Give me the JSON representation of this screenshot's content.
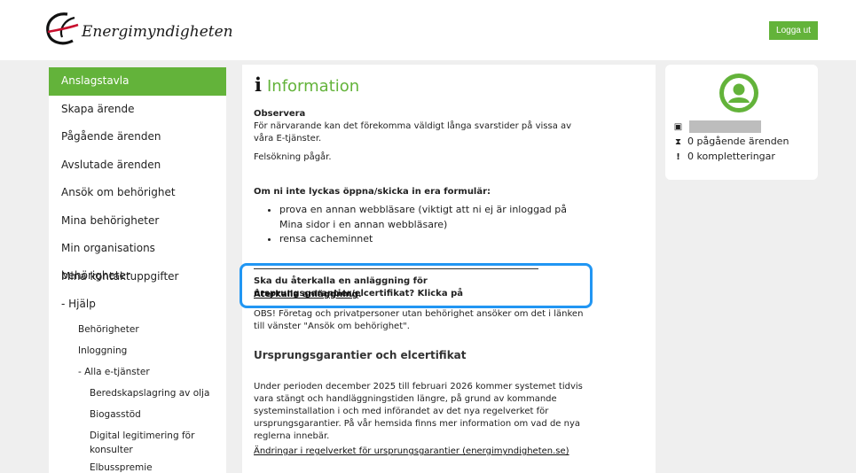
{
  "header": {
    "logo_text": "Energimyndigheten",
    "logout_label": "Logga ut"
  },
  "sidebar": {
    "items": [
      {
        "label": "Anslagstavla",
        "active": true
      },
      {
        "label": "Skapa ärende"
      },
      {
        "label": "Pågående ärenden"
      },
      {
        "label": "Avslutade ärenden"
      },
      {
        "label": "Ansök om behörighet"
      },
      {
        "label": "Mina behörigheter"
      },
      {
        "label": "Min organisations behörigheter"
      },
      {
        "label": "Mina kontaktuppgifter"
      },
      {
        "label": "- Hjälp"
      }
    ],
    "sub_items": [
      "Behörigheter",
      "Inloggning",
      "- Alla e-tjänster"
    ],
    "services": [
      "Beredskapslagring av olja",
      "Biogasstöd",
      "Digital legitimering för",
      "konsulter",
      "Elbusspremie"
    ]
  },
  "main": {
    "title": "Information",
    "observera_heading": "Observera",
    "observera_text_1": "För närvarande kan det förekomma väldigt långa svarstider på vissa av",
    "observera_text_2": "våra E-tjänster.",
    "felsokning": "Felsökning pågår.",
    "forms_heading": "Om ni inte lyckas öppna/skicka in era formulär:",
    "bullets": [
      "prova en annan webbläsare (viktigt att ni ej är inloggad på Mina sidor i en annan webbläsare)",
      "rensa cacheminnet"
    ],
    "recall_text": "Ska du återkalla en anläggning för ursprungsgarantier/elcertifikat? Klicka på",
    "recall_link": "Återkalla anläggning",
    "recall_end": ".",
    "obs_text_1": "OBS! Företag och privatpersoner utan behörighet ansöker om det i länken",
    "obs_text_2": "till vänster \"Ansök om behörighet\".",
    "section_heading": "Ursprungsgarantier och elcertifikat",
    "period_lines": [
      "Under perioden december 2025 till februari 2026 kommer systemet tidvis",
      "vara stängt och handläggningstiden längre, på grund av kommande",
      "systeminstallation i och med införandet av det nya regelverket för",
      "ursprungsgarantier. På vår hemsida finns mer information om vad de nya",
      "reglerna innebär."
    ],
    "regel_link": "Ändringar i regelverket för ursprungsgarantier (energimyndigheten.se)"
  },
  "profile": {
    "pending": "0 pågående ärenden",
    "complements": "0 kompletteringar"
  },
  "colors": {
    "accent": "#63b33a",
    "highlight": "#2196f3"
  }
}
